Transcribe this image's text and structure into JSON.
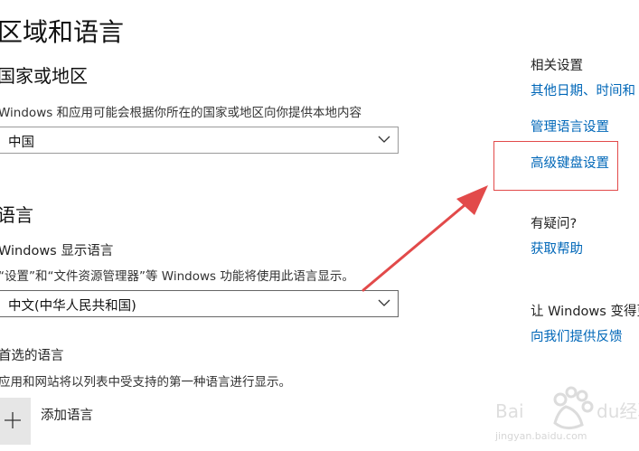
{
  "page": {
    "title": "区域和语言"
  },
  "region": {
    "heading": "国家或地区",
    "description": "Windows 和应用可能会根据你所在的国家或地区向你提供本地内容",
    "country_value": "中国"
  },
  "language": {
    "heading": "语言",
    "display_language_label": "Windows 显示语言",
    "display_language_desc": "“设置”和“文件资源管理器”等 Windows 功能将使用此语言显示。",
    "display_language_value": "中文(中华人民共和国)",
    "preferred_label": "首选的语言",
    "preferred_desc": "应用和网站将以列表中受支持的第一种语言进行显示。",
    "add_language_label": "添加语言"
  },
  "sidebar": {
    "related_title": "相关设置",
    "link_date_time": "其他日期、时间和",
    "link_manage_language": "管理语言设置",
    "link_advanced_keyboard": "高级键盘设置",
    "question_title": "有疑问?",
    "link_get_help": "获取帮助",
    "feedback_title": "让 Windows 变得更",
    "link_feedback": "向我们提供反馈"
  },
  "watermark": {
    "brand": "Baidu经验",
    "url": "jingyan.baidu.com"
  },
  "colors": {
    "link": "#0067b8",
    "annotation": "#e24a4a"
  }
}
